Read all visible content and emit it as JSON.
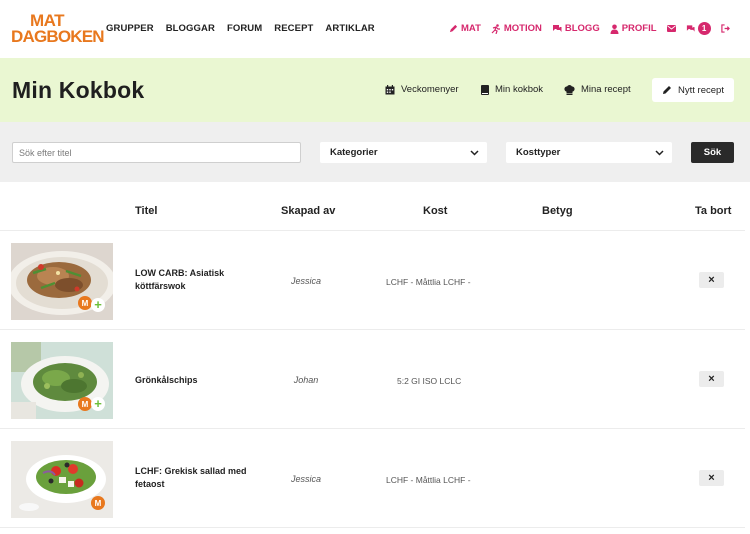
{
  "logo": {
    "line1": "MAT",
    "line2": "DAGBOKEN"
  },
  "nav": {
    "main": [
      "GRUPPER",
      "BLOGGAR",
      "FORUM",
      "RECEPT",
      "ARTIKLAR"
    ],
    "right": [
      {
        "label": "MAT",
        "icon": "pencil-icon"
      },
      {
        "label": "MOTION",
        "icon": "runner-icon"
      },
      {
        "label": "BLOGG",
        "icon": "chat-icon"
      },
      {
        "label": "PROFIL",
        "icon": "user-icon"
      }
    ],
    "notification_count": "1"
  },
  "header": {
    "title": "Min Kokbok",
    "links": [
      {
        "label": "Veckomenyer",
        "icon": "calendar-icon"
      },
      {
        "label": "Min kokbok",
        "icon": "book-icon"
      },
      {
        "label": "Mina recept",
        "icon": "chef-hat-icon"
      }
    ],
    "new_recipe": "Nytt recept"
  },
  "filters": {
    "search_placeholder": "Sök efter titel",
    "category": "Kategorier",
    "diet_type": "Kosttyper",
    "search_button": "Sök"
  },
  "table": {
    "columns": [
      "Titel",
      "Skapad av",
      "Kost",
      "Betyg",
      "Ta bort"
    ],
    "rows": [
      {
        "title": "LOW CARB: Asiatisk köttfärswok",
        "author": "Jessica",
        "diet": "LCHF - Måttlia LCHF -",
        "rating": "",
        "remove": "×",
        "badge_m": "M",
        "badge_plus": "+"
      },
      {
        "title": "Grönkålschips",
        "author": "Johan",
        "diet": "5:2 GI ISO LCLC",
        "rating": "",
        "remove": "×",
        "badge_m": "M",
        "badge_plus": "+"
      },
      {
        "title": "LCHF: Grekisk sallad med fetaost",
        "author": "Jessica",
        "diet": "LCHF - Måttlia LCHF -",
        "rating": "",
        "remove": "×",
        "badge_m": "M",
        "badge_plus": ""
      }
    ]
  },
  "colors": {
    "brand_orange": "#e8781e",
    "accent_pink": "#d6286d",
    "header_green": "#eaf7d2"
  }
}
